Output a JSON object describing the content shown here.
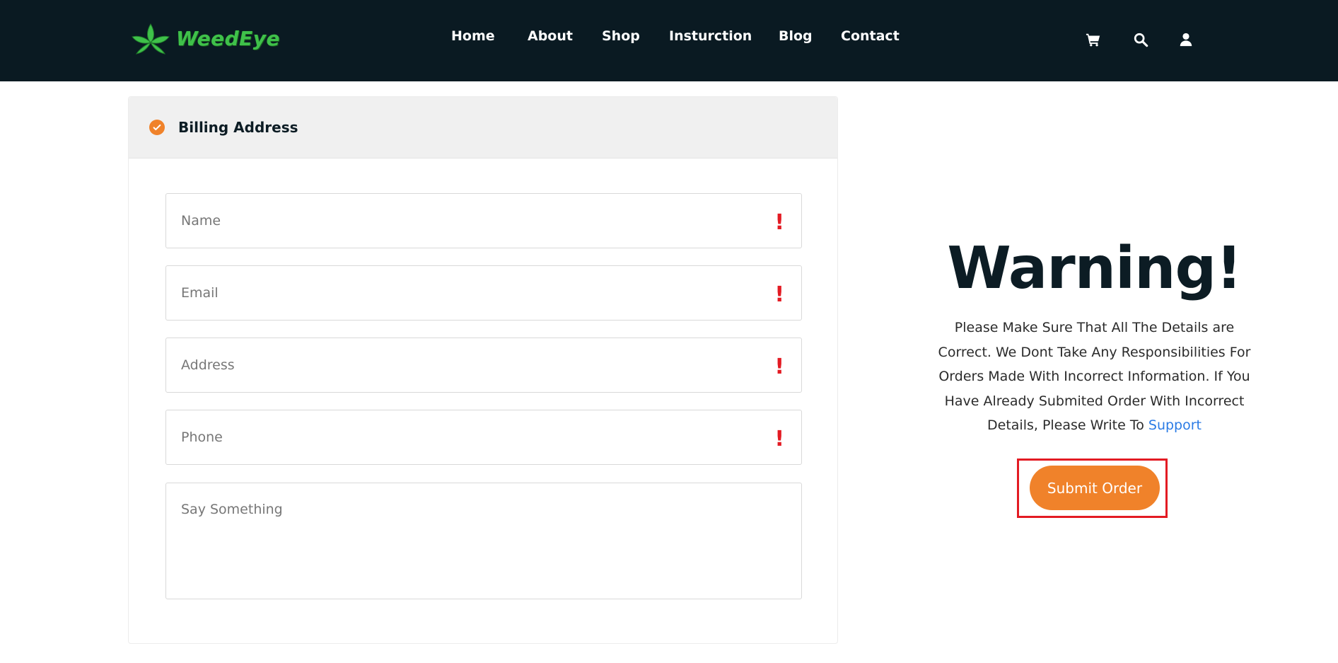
{
  "header": {
    "logo_text": "WeedEye",
    "nav": [
      {
        "label": "Home"
      },
      {
        "label": "About"
      },
      {
        "label": "Shop"
      },
      {
        "label": "Insturction"
      },
      {
        "label": "Blog"
      },
      {
        "label": "Contact"
      }
    ],
    "icons": [
      "cart-icon",
      "search-icon",
      "user-icon"
    ],
    "colors": {
      "background": "#0a1a22",
      "logo": "#3fc14a"
    }
  },
  "billing": {
    "title": "Billing Address",
    "fields": [
      {
        "placeholder": "Name",
        "value": "",
        "required_mark": "!"
      },
      {
        "placeholder": "Email",
        "value": "",
        "required_mark": "!"
      },
      {
        "placeholder": "Address",
        "value": "",
        "required_mark": "!"
      },
      {
        "placeholder": "Phone",
        "value": "",
        "required_mark": "!"
      },
      {
        "placeholder": "Say Something",
        "value": ""
      }
    ]
  },
  "warning": {
    "title": "Warning!",
    "text": "Please Make Sure That All The Details are Correct. We Dont Take Any Responsibilities For Orders Made With Incorrect Information. If You Have Already Submited Order With Incorrect Details, Please Write To ",
    "link_label": "Support"
  },
  "actions": {
    "submit_label": "Submit Order"
  },
  "colors": {
    "accent": "#f0822a",
    "required": "#e31b23",
    "link": "#2b7be5",
    "highlight_frame": "#e31b23"
  }
}
